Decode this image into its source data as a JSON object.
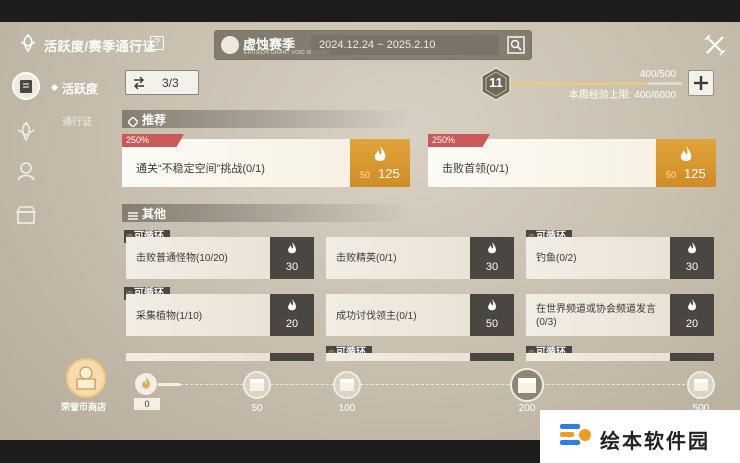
{
  "header": {
    "title": "活跃度/赛季通行证",
    "help_glyph": "?",
    "season_name": "虚蚀赛季",
    "season_subtitle": "EROSION GRANT VOID SEASON",
    "season_dates": "2024.12.24 ~ 2025.2.10"
  },
  "sidebar": {
    "active_item": "活跃度",
    "sub_item": "通行证"
  },
  "pager": {
    "label": "3/3"
  },
  "level": {
    "value": "11",
    "xp_text": "400/500",
    "xp_progress": 0.8,
    "weekly_limit": "本周经验上限: 400/6000",
    "plus_glyph": "+"
  },
  "sections": {
    "recommended": "推荐",
    "other": "其他"
  },
  "recommended": [
    {
      "bonus": "250%",
      "text": "通关“不稳定空间”挑战(0/1)",
      "old": "50",
      "reward": "125"
    },
    {
      "bonus": "250%",
      "text": "击败首领(0/1)",
      "old": "50",
      "reward": "125"
    }
  ],
  "loop_label": "可循环",
  "tasks": [
    {
      "text": "击败普通怪物(10/20)",
      "reward": "30",
      "loop": true
    },
    {
      "text": "击败精英(0/1)",
      "reward": "30",
      "loop": false
    },
    {
      "text": "钓鱼(0/2)",
      "reward": "30",
      "loop": true
    },
    {
      "text": "采集植物(1/10)",
      "reward": "20",
      "loop": true
    },
    {
      "text": "成功讨伐领主(0/1)",
      "reward": "50",
      "loop": false
    },
    {
      "text": "在世界频道或协会频道发言(0/3)",
      "reward": "20",
      "loop": false
    }
  ],
  "track": {
    "shop_label": "荣誉币商店",
    "start_value": "0",
    "milestones": [
      "50",
      "100",
      "200",
      "500"
    ]
  },
  "watermark": {
    "text": "绘本软件园"
  },
  "colors": {
    "accent_orange": "#d89a30",
    "tag_red": "#c95a5a",
    "dark_reward": "#4a4742"
  }
}
